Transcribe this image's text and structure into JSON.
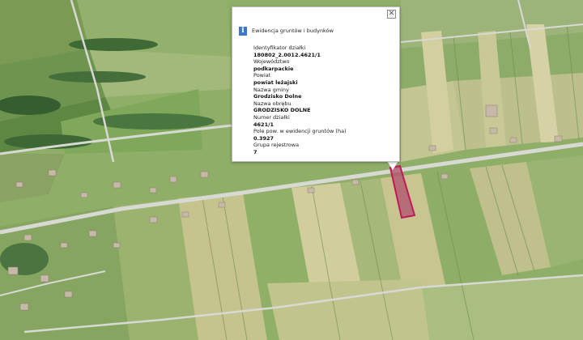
{
  "popup": {
    "title": "Ewidencja gruntów i budynków",
    "close_glyph": "✕",
    "info_glyph": "i",
    "fields": [
      {
        "label": "Identyfikator działki",
        "value": "180802_2.0012.4621/1"
      },
      {
        "label": "Województwo",
        "value": "podkarpackie"
      },
      {
        "label": "Powiat",
        "value": "powiat leżajski"
      },
      {
        "label": "Nazwa gminy",
        "value": "Grodzisko Dolne"
      },
      {
        "label": "Nazwa obrębu",
        "value": "GRODZISKO DOLNE"
      },
      {
        "label": "Numer działki",
        "value": "4621/1"
      },
      {
        "label": "Pole pow. w ewidencji gruntów (ha)",
        "value": "0.3927"
      },
      {
        "label": "Grupa rejestrowa",
        "value": "7"
      }
    ]
  },
  "colors": {
    "parcel_outline": "#c2185b",
    "parcel_fill": "#b0506e",
    "road": "#d9d9d4",
    "field_light": "#c9c98f",
    "field_green": "#7ea257",
    "forest": "#3f6a36",
    "info_icon": "#3b78c6"
  },
  "icons": {
    "close": "close-icon",
    "info": "info-icon"
  }
}
